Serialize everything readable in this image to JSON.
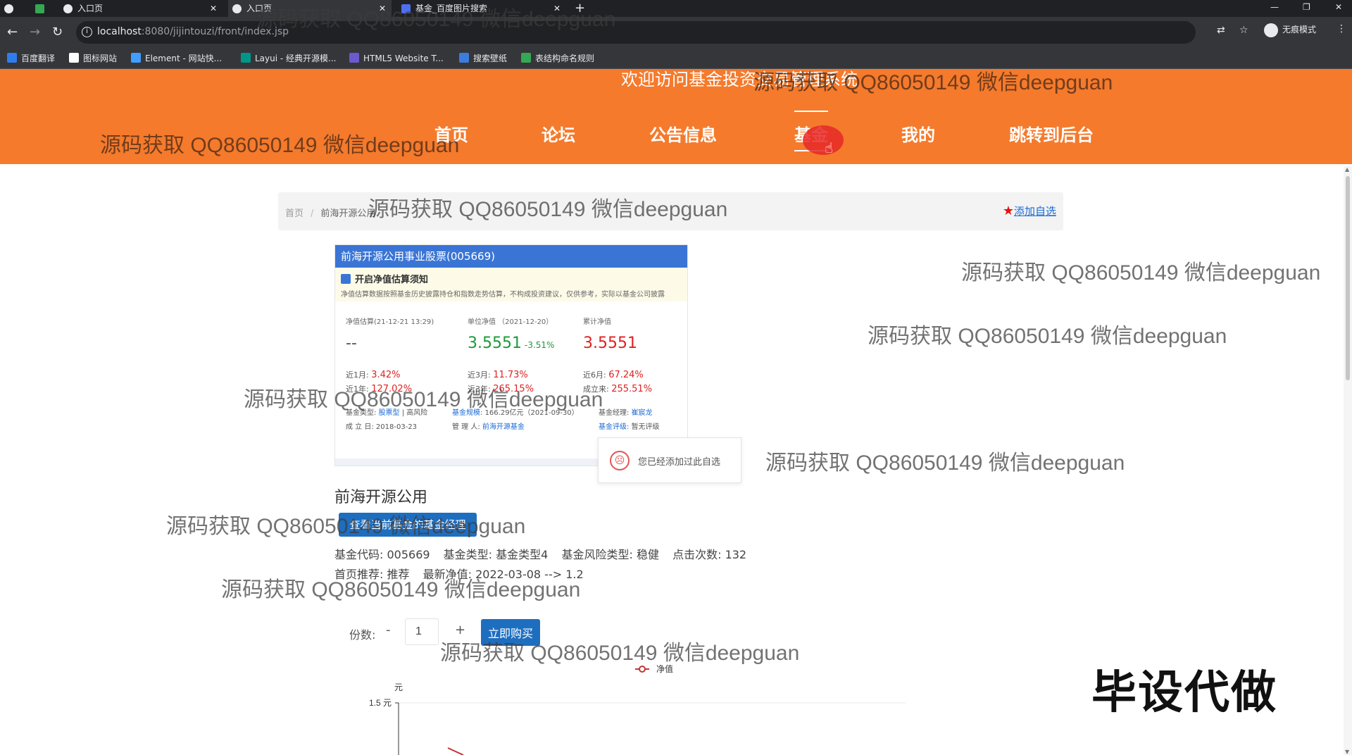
{
  "browser": {
    "tabs": [
      {
        "title": "",
        "icon": "browser-circle-icon"
      },
      {
        "title": "",
        "icon": "sheet-app-icon"
      },
      {
        "title": "入口页",
        "icon": "globe-icon"
      },
      {
        "title": "入口页",
        "icon": "globe-icon"
      },
      {
        "title": "基金_百度图片搜索",
        "icon": "baidu-paw-icon"
      }
    ],
    "url_host": "localhost",
    "url_path": ":8080/jijintouzi/front/index.jsp",
    "incognito_label": "无痕模式",
    "bookmarks": [
      {
        "label": "百度翻译",
        "color": "#2f7dec"
      },
      {
        "label": "图标网站",
        "color": "#ffffff"
      },
      {
        "label": "Element - 网站快...",
        "color": "#409eff"
      },
      {
        "label": "Layui - 经典开源模...",
        "color": "#009688"
      },
      {
        "label": "HTML5 Website T...",
        "color": "#6a5acd"
      },
      {
        "label": "搜索壁纸",
        "color": "#3b7ddd"
      },
      {
        "label": "表结构命名规则",
        "color": "#34a853"
      }
    ]
  },
  "header": {
    "welcome": "欢迎访问基金投资交易管理系统",
    "nav": [
      "首页",
      "论坛",
      "公告信息",
      "基金",
      "我的",
      "跳转到后台"
    ],
    "active_nav": "基金",
    "color": "#f57a2c"
  },
  "breadcrumb": {
    "home": "首页",
    "sep": "/",
    "current": "前海开源公用",
    "add_fav": "添加自选"
  },
  "fund_card": {
    "title": "前海开源公用事业股票(005669)",
    "notice_title": "开启净值估算须知",
    "notice_text": "净值估算数据按照基金历史披露持仓和指数走势估算，不构成投资建议，仅供参考，实际以基金公司披露",
    "est_label": "净值估算(21-12-21 13:29)",
    "est_value": "--",
    "unit_label": "单位净值 （2021-12-20）",
    "unit_value": "3.5551",
    "unit_change": "-3.51%",
    "acc_label": "累计净值",
    "acc_value": "3.5551",
    "perf": [
      {
        "label": "近1月:",
        "value": "3.42%"
      },
      {
        "label": "近3月:",
        "value": "11.73%"
      },
      {
        "label": "近6月:",
        "value": "67.24%"
      },
      {
        "label": "近1年:",
        "value": "127.02%"
      },
      {
        "label": "近3年:",
        "value": "265.15%"
      },
      {
        "label": "成立来:",
        "value": "255.51%"
      }
    ],
    "meta": {
      "type_label": "基金类型:",
      "type_value": "股票型",
      "risk_value": "| 高风险",
      "scale_label": "基金规模:",
      "scale_value": "166.29亿元（2021-09-30）",
      "manager_label": "基金经理:",
      "manager_value": "崔宸龙",
      "found_label": "成 立 日:",
      "found_value": "2018-03-23",
      "admin_label": "管 理 人:",
      "admin_value": "前海开源基金",
      "rating_label": "基金评级:",
      "rating_value": "暂无评级"
    }
  },
  "toast": {
    "message": "您已经添加过此自选"
  },
  "fund": {
    "name": "前海开源公用",
    "manager_button": "查看当前基金的基金经理",
    "code_label": "基金代码:",
    "code": "005669",
    "type_label": "基金类型:",
    "type": "基金类型4",
    "risk_label": "基金风险类型:",
    "risk": "稳健",
    "clicks_label": "点击次数:",
    "clicks": "132",
    "recommend_label": "首页推荐:",
    "recommend": "推荐",
    "latest_label": "最新净值:",
    "latest": "2022-03-08 --> 1.2"
  },
  "purchase": {
    "qty_label": "份数:",
    "minus": "-",
    "plus": "+",
    "qty_value": "1",
    "buy_label": "立即购买"
  },
  "chart_data": {
    "type": "line",
    "legend": [
      "净值"
    ],
    "legend_position": "top-center",
    "ylabel": "元",
    "ytick_labels": [
      "1.5 元"
    ],
    "ylim": [
      0,
      1.5
    ],
    "series": [
      {
        "name": "净值",
        "color": "#c23531",
        "values": [
          1.3
        ]
      }
    ]
  },
  "overlays": {
    "watermark": "源码获取 QQ86050149 微信deepguan",
    "corner_stamp": "毕设代做"
  }
}
